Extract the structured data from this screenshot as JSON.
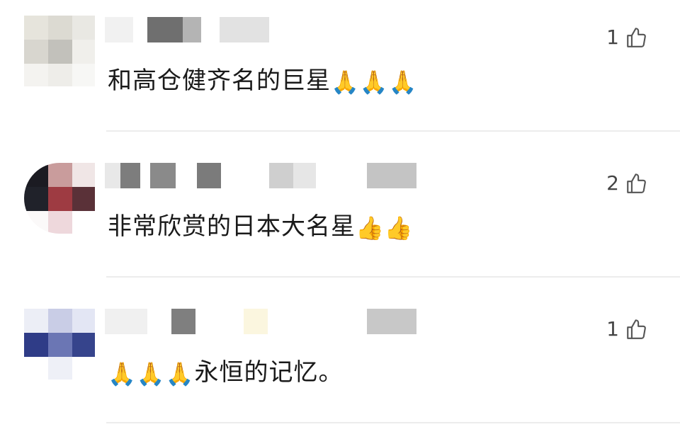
{
  "comments": [
    {
      "text": "和高仓健齐名的巨星",
      "emoji_glyph": "🙏",
      "emoji_name": "folded-hands",
      "likes": "1"
    },
    {
      "text": "非常欣赏的日本大名星",
      "emoji_glyph": "👍",
      "emoji_name": "thumbs-up",
      "likes": "2"
    },
    {
      "text": "永恒的记忆。",
      "emoji_glyph": "🙏",
      "emoji_name": "folded-hands",
      "likes": "1"
    }
  ],
  "icons": {
    "like": "thumbs-up-outline-icon"
  },
  "colors": {
    "background": "#ffffff",
    "text": "#1a1a1a",
    "like_count": "#444444",
    "divider": "#ececec"
  }
}
